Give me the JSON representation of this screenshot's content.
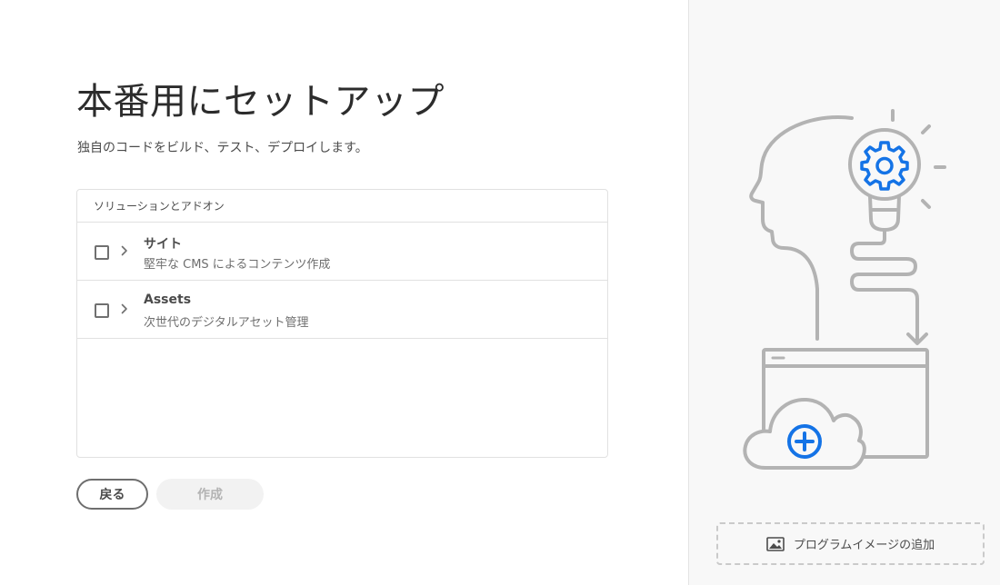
{
  "page": {
    "title": "本番用にセットアップ",
    "subtitle": "独自のコードをビルド、テスト、デプロイします。"
  },
  "solutions": {
    "header": "ソリューションとアドオン",
    "items": [
      {
        "title": "サイト",
        "description": "堅牢な CMS によるコンテンツ作成",
        "checked": false
      },
      {
        "title": "Assets",
        "description": "次世代のデジタルアセット管理",
        "checked": false
      }
    ]
  },
  "actions": {
    "back_label": "戻る",
    "create_label": "作成"
  },
  "program_image": {
    "add_label": "プログラムイメージの追加",
    "icon": "image-icon"
  },
  "colors": {
    "accent_blue": "#1473e6",
    "illustration_gray": "#b3b3b3"
  }
}
